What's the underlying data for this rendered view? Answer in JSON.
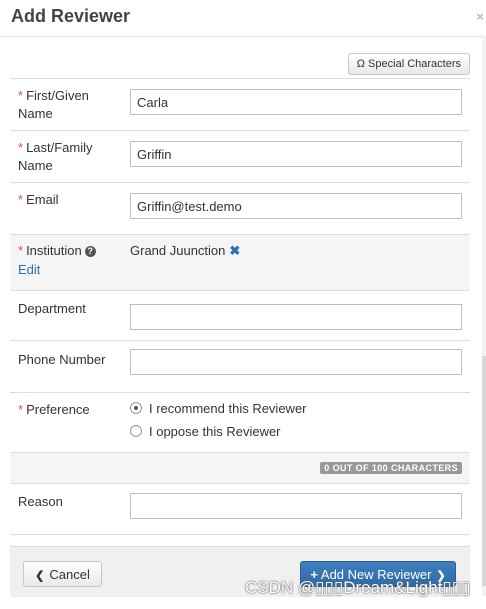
{
  "dialog": {
    "title": "Add Reviewer",
    "close_glyph": "×"
  },
  "toolbar": {
    "special_chars_label": "Ω Special Characters"
  },
  "fields": {
    "required_mark": "*",
    "first_name": {
      "label": "First/Given Name",
      "value": "Carla"
    },
    "last_name": {
      "label": "Last/Family Name",
      "value": "Griffin"
    },
    "email": {
      "label": "Email",
      "value": "Griffin@test.demo"
    },
    "institution": {
      "label": "Institution",
      "value": "Grand Juunction",
      "edit_label": "Edit",
      "remove_glyph": "✖",
      "help_glyph": "?"
    },
    "department": {
      "label": "Department",
      "value": ""
    },
    "phone": {
      "label": "Phone Number",
      "value": ""
    },
    "preference": {
      "label": "Preference",
      "options": [
        "I recommend this Reviewer",
        "I oppose this Reviewer"
      ],
      "selected": "I recommend this Reviewer"
    },
    "char_counter": "0 OUT OF 100 CHARACTERS",
    "reason": {
      "label": "Reason",
      "value": ""
    }
  },
  "footer": {
    "cancel_label": "Cancel",
    "cancel_icon": "❮",
    "add_label": "Add New Reviewer",
    "add_icon": "+",
    "add_arrow": "❯"
  },
  "watermark": "CSDN @▯▯▯Dream&Light▯▯▯"
}
